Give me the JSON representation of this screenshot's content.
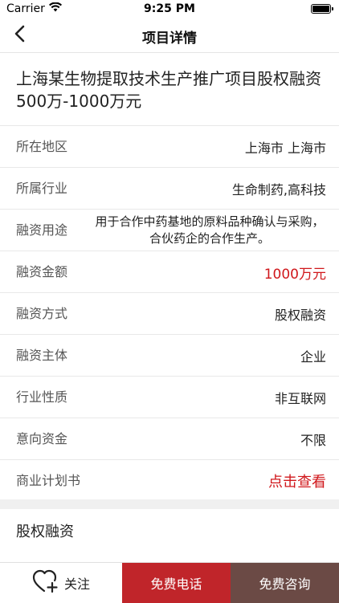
{
  "status_bar": {
    "carrier": "Carrier",
    "time": "9:25 PM",
    "battery_level": 1.0
  },
  "nav": {
    "title": "项目详情",
    "back_icon": "chevron-left-icon"
  },
  "project": {
    "title": "上海某生物提取技术生产推广项目股权融资500万-1000万元"
  },
  "details": [
    {
      "label": "所在地区",
      "value": "上海市 上海市"
    },
    {
      "label": "所属行业",
      "value": "生命制药,高科技"
    },
    {
      "label": "融资用途",
      "value": "用于合作中药基地的原料品种确认与采购，合伙药企的合作生产。"
    },
    {
      "label": "融资金额",
      "value": "1000万元"
    },
    {
      "label": "融资方式",
      "value": "股权融资"
    },
    {
      "label": "融资主体",
      "value": "企业"
    },
    {
      "label": "行业性质",
      "value": "非互联网"
    },
    {
      "label": "意向资金",
      "value": "不限"
    },
    {
      "label": "商业计划书",
      "value": "点击查看"
    }
  ],
  "section": {
    "title": "股权融资"
  },
  "bottom_bar": {
    "follow_label": "关注",
    "call_label": "免费电话",
    "consult_label": "免费咨询"
  },
  "colors": {
    "accent_red": "#d0171b",
    "call_bg": "#c0252a",
    "consult_bg": "#6b4a45"
  }
}
